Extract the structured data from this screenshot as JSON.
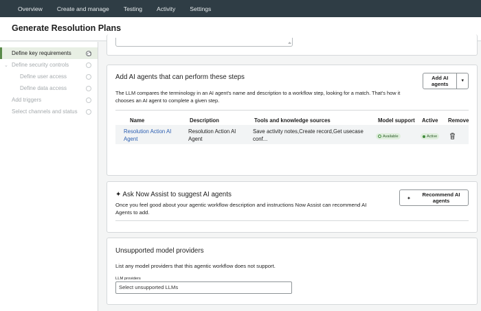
{
  "nav": {
    "items": [
      {
        "label": "Overview"
      },
      {
        "label": "Create and manage"
      },
      {
        "label": "Testing"
      },
      {
        "label": "Activity"
      },
      {
        "label": "Settings"
      }
    ]
  },
  "page": {
    "title": "Generate Resolution Plans"
  },
  "sidebar": {
    "steps": [
      {
        "label": "Define key requirements",
        "state": "in-progress"
      },
      {
        "label": "Define security controls",
        "state": "pending"
      },
      {
        "label": "Define user access",
        "state": "pending"
      },
      {
        "label": "Define data access",
        "state": "pending"
      },
      {
        "label": "Add triggers",
        "state": "pending"
      },
      {
        "label": "Select channels and status",
        "state": "pending"
      }
    ]
  },
  "agents_section": {
    "title": "Add AI agents that can perform these steps",
    "description_line1": "The LLM compares the terminology in an AI agent's name and description to a workflow step, looking for a match. That's how it",
    "description_line2": "chooses an AI agent to complete a given step.",
    "add_button_line1": "Add AI",
    "add_button_line2": "agents",
    "columns": [
      "Name",
      "Description",
      "Tools and knowledge sources",
      "Model support",
      "Active",
      "Remove"
    ],
    "rows": [
      {
        "name_line1": "Resolution Action AI",
        "name_line2": "Agent",
        "description_line1": "Resolution Action AI",
        "description_line2": "Agent",
        "tools_line1": "Save activity notes,Create record,Get usecase",
        "tools_line2": "conf...",
        "model_support": "Available",
        "active": "Active"
      }
    ]
  },
  "now_assist_section": {
    "title": "Ask Now Assist to suggest AI agents",
    "description_line1": "Once you feel good about your agentic workflow description and instructions Now Assist can recommend AI",
    "description_line2": "Agents to add.",
    "button_line1": "Recommend AI",
    "button_line2": "agents"
  },
  "providers_section": {
    "title": "Unsupported model providers",
    "description": "List any model providers that this agentic workflow does not support.",
    "field_label": "LLM providers",
    "field_value": "Select unsupported LLMs"
  },
  "colors": {
    "topnav_bg": "#2f3d45",
    "active_step_bg": "#e8efe4",
    "link": "#2a5db0",
    "status_green": "#3f8a3a"
  }
}
